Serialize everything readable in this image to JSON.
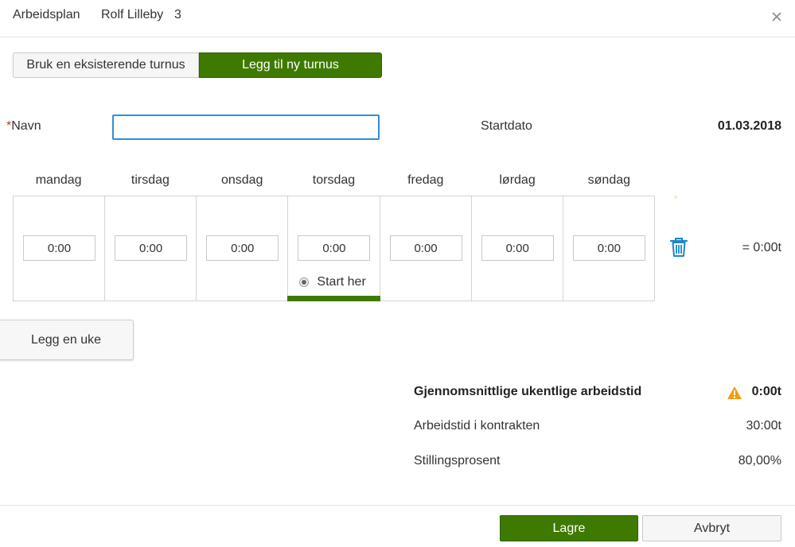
{
  "header": {
    "title": "Arbeidsplan",
    "employee_name": "Rolf Lilleby",
    "employee_number": "3",
    "close_icon": "close-icon"
  },
  "toggle": {
    "existing_label": "Bruk en eksisterende turnus",
    "new_label": "Legg til ny turnus",
    "active": "new"
  },
  "form": {
    "required_marker": "*",
    "name_label": "Navn",
    "name_value": "",
    "start_date_label": "Startdato",
    "start_date_value": "01.03.2018"
  },
  "schedule": {
    "days": [
      "mandag",
      "tirsdag",
      "onsdag",
      "torsdag",
      "fredag",
      "lørdag",
      "søndag"
    ],
    "weeks": [
      {
        "hours": [
          "0:00",
          "0:00",
          "0:00",
          "0:00",
          "0:00",
          "0:00",
          "0:00"
        ],
        "total": "= 0:00t",
        "delete_icon": "trash-icon"
      }
    ],
    "start_day_index": 3,
    "start_here_label": "Start her",
    "add_week_label": "Legg en uke"
  },
  "summary": {
    "avg_label": "Gjennomsnittlige ukentlige arbeidstid",
    "avg_value": "0:00t",
    "warning_icon": "warning-icon",
    "contract_label": "Arbeidstid i kontrakten",
    "contract_value": "30:00t",
    "position_label": "Stillingsprosent",
    "position_value": "80,00%"
  },
  "footer": {
    "save_label": "Lagre",
    "cancel_label": "Avbryt"
  },
  "colors": {
    "accent_green": "#3f7a00",
    "focus_blue": "#2f8fd8",
    "warning_orange": "#f39c12",
    "required_red": "#c0392b"
  }
}
